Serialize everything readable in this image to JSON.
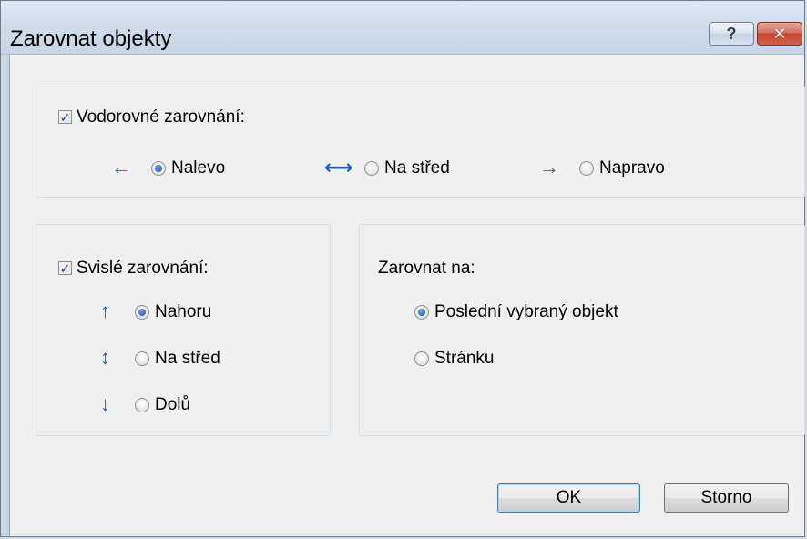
{
  "window": {
    "title": "Zarovnat objekty",
    "help_label": "?",
    "close_label": "✕"
  },
  "horizontal": {
    "checkbox_label": "Vodorovné zarovnání:",
    "checked": true,
    "options": [
      {
        "label": "Nalevo",
        "selected": true,
        "icon": "arrow-left-icon"
      },
      {
        "label": "Na střed",
        "selected": false,
        "icon": "horizontal-center-icon"
      },
      {
        "label": "Napravo",
        "selected": false,
        "icon": "arrow-right-icon"
      }
    ]
  },
  "vertical": {
    "checkbox_label": "Svislé zarovnání:",
    "checked": true,
    "options": [
      {
        "label": "Nahoru",
        "selected": true,
        "icon": "arrow-up-icon"
      },
      {
        "label": "Na střed",
        "selected": false,
        "icon": "vertical-center-icon"
      },
      {
        "label": "Dolů",
        "selected": false,
        "icon": "arrow-down-icon"
      }
    ]
  },
  "align_to": {
    "heading": "Zarovnat na:",
    "options": [
      {
        "label": "Poslední vybraný objekt",
        "selected": true
      },
      {
        "label": "Stránku",
        "selected": false
      }
    ]
  },
  "buttons": {
    "ok_label": "OK",
    "cancel_label": "Storno"
  },
  "colors": {
    "accent": "#1d5fbf",
    "title_bar": "#cfdceb",
    "close": "#c2452c"
  }
}
